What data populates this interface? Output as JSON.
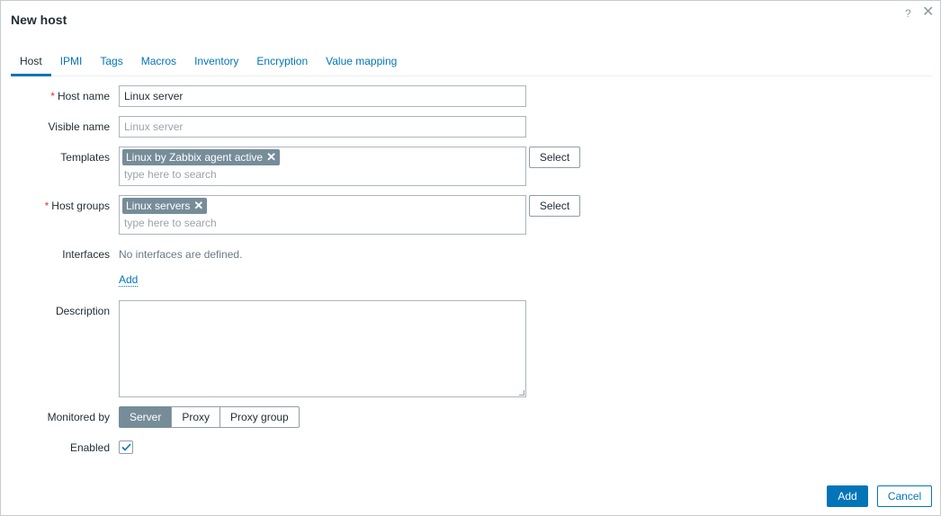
{
  "dialog": {
    "title": "New host",
    "help_glyph": "?",
    "close_glyph": "✕"
  },
  "tabs": [
    {
      "label": "Host",
      "active": true
    },
    {
      "label": "IPMI"
    },
    {
      "label": "Tags"
    },
    {
      "label": "Macros"
    },
    {
      "label": "Inventory"
    },
    {
      "label": "Encryption"
    },
    {
      "label": "Value mapping"
    }
  ],
  "form": {
    "host_name": {
      "label": "Host name",
      "required": "*",
      "value": "Linux server"
    },
    "visible_name": {
      "label": "Visible name",
      "placeholder": "Linux server"
    },
    "templates": {
      "label": "Templates",
      "chips": [
        "Linux by Zabbix agent active"
      ],
      "search_placeholder": "type here to search",
      "select_label": "Select"
    },
    "host_groups": {
      "label": "Host groups",
      "required": "*",
      "chips": [
        "Linux servers"
      ],
      "search_placeholder": "type here to search",
      "select_label": "Select"
    },
    "interfaces": {
      "label": "Interfaces",
      "empty_text": "No interfaces are defined.",
      "add_link": "Add"
    },
    "description": {
      "label": "Description",
      "value": ""
    },
    "monitored_by": {
      "label": "Monitored by",
      "options": [
        "Server",
        "Proxy",
        "Proxy group"
      ],
      "selected": "Server"
    },
    "enabled": {
      "label": "Enabled",
      "checked": true
    }
  },
  "footer": {
    "add_label": "Add",
    "cancel_label": "Cancel"
  },
  "colors": {
    "accent": "#0275b8",
    "chip": "#768d99",
    "required": "#e33734"
  }
}
